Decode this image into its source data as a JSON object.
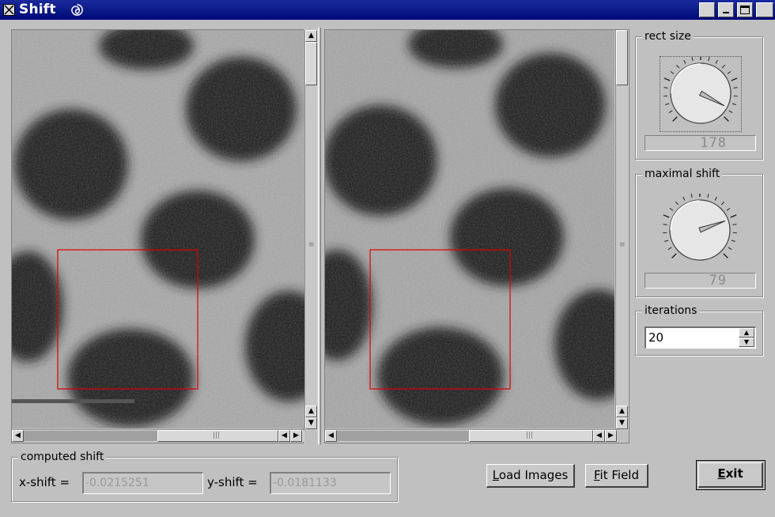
{
  "window": {
    "title": "Shift"
  },
  "rect_size": {
    "label": "rect size",
    "value": "178",
    "needle_angle_deg": 118
  },
  "maximal_shift": {
    "label": "maximal shift",
    "value": "79",
    "needle_angle_deg": 70
  },
  "iterations": {
    "label": "iterations",
    "value": "20"
  },
  "computed_shift": {
    "label": "computed shift",
    "x_label": "x-shift =",
    "x_value": "-0.0215251",
    "y_label": "y-shift =",
    "y_value": "-0.0181133"
  },
  "buttons": {
    "load_images_prefix": "L",
    "load_images_rest": "oad Images",
    "fit_field_prefix": "F",
    "fit_field_rest": "it Field",
    "exit_prefix": "E",
    "exit_rest": "xit"
  },
  "colors": {
    "titlebar": "#0a1a8c",
    "selection_rect": "#e00000",
    "background": "#c0c0c0"
  }
}
